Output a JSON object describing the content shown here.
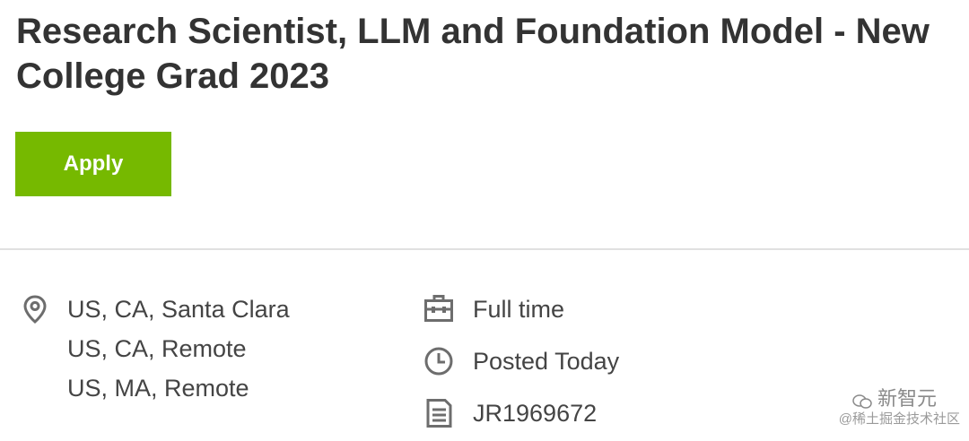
{
  "job": {
    "title": "Research Scientist, LLM and Foundation Model - New College Grad 2023",
    "apply_label": "Apply"
  },
  "locations": [
    "US, CA, Santa Clara",
    "US, CA, Remote",
    "US, MA, Remote"
  ],
  "details": {
    "employment_type": "Full time",
    "posted": "Posted Today",
    "job_id": "JR1969672"
  },
  "icons": {
    "location": "location-pin-icon",
    "employment": "briefcase-icon",
    "posted": "clock-icon",
    "job_id": "document-icon"
  },
  "watermark": {
    "logo_text": "新智元",
    "subtext": "@稀土掘金技术社区"
  },
  "colors": {
    "accent": "#76b900",
    "text": "#333333",
    "icon": "#6d6d6d",
    "divider": "#e0e0e0"
  }
}
